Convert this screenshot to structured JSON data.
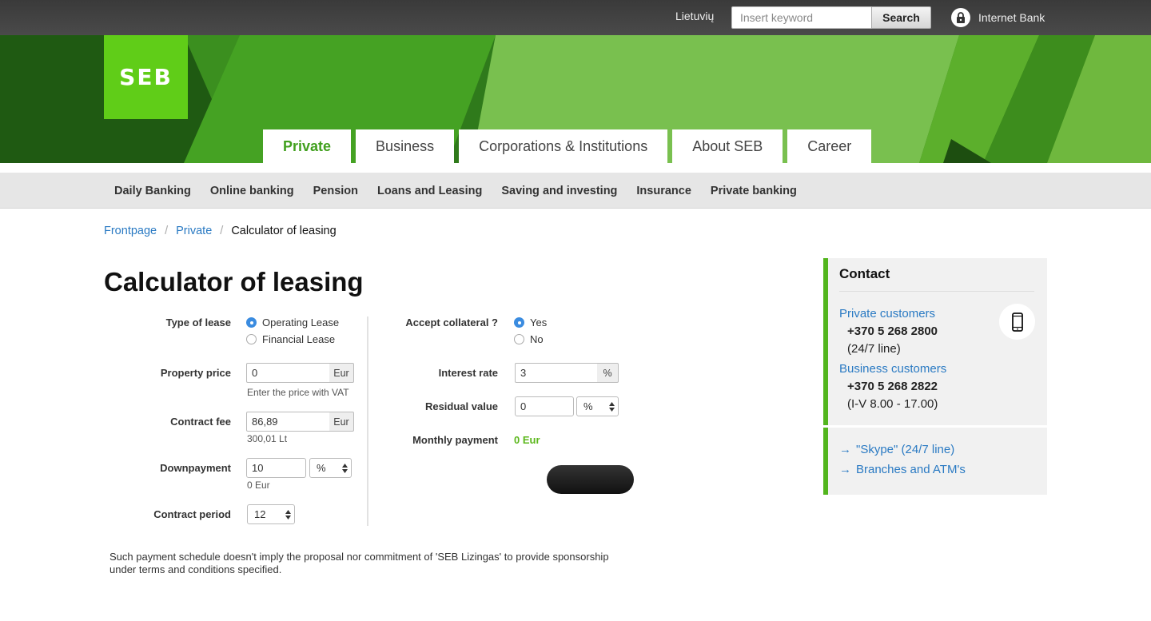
{
  "topbar": {
    "language": "Lietuvių",
    "search_placeholder": "Insert keyword",
    "search_button": "Search",
    "internet_bank": "Internet Bank"
  },
  "logo": {
    "text": "SEB"
  },
  "tabs": [
    {
      "label": "Private",
      "active": true
    },
    {
      "label": "Business"
    },
    {
      "label": "Corporations & Institutions"
    },
    {
      "label": "About SEB"
    },
    {
      "label": "Career"
    }
  ],
  "subnav": [
    "Daily Banking",
    "Online banking",
    "Pension",
    "Loans and Leasing",
    "Saving and investing",
    "Insurance",
    "Private banking"
  ],
  "breadcrumb": {
    "items": [
      "Frontpage",
      "Private"
    ],
    "separator": "/",
    "current": "Calculator of leasing"
  },
  "page_title": "Calculator of leasing",
  "form": {
    "type_of_lease": {
      "label": "Type of lease",
      "options": [
        "Operating Lease",
        "Financial Lease"
      ],
      "selected": "Operating Lease"
    },
    "property_price": {
      "label": "Property price",
      "value": "0",
      "unit": "Eur",
      "hint": "Enter the price with VAT"
    },
    "contract_fee": {
      "label": "Contract fee",
      "value": "86,89",
      "unit": "Eur",
      "hint": "300,01 Lt"
    },
    "downpayment": {
      "label": "Downpayment",
      "value": "10",
      "unit": "%",
      "hint": "0 Eur"
    },
    "contract_period": {
      "label": "Contract period",
      "value": "12"
    },
    "accept_collateral": {
      "label": "Accept collateral ?",
      "options": [
        "Yes",
        "No"
      ],
      "selected": "Yes"
    },
    "interest_rate": {
      "label": "Interest rate",
      "value": "3",
      "unit": "%"
    },
    "residual_value": {
      "label": "Residual value",
      "value": "0",
      "unit": "%"
    },
    "monthly_payment": {
      "label": "Monthly payment",
      "value": "0 Eur"
    }
  },
  "disclaimer": "Such payment schedule doesn't imply the proposal nor commitment of 'SEB Lizingas' to provide sponsorship under terms and conditions specified.",
  "contact": {
    "title": "Contact",
    "private_label": "Private customers",
    "private_phone": "+370 5 268 2800",
    "private_hours": "(24/7 line)",
    "business_label": "Business customers",
    "business_phone": "+370 5 268 2822",
    "business_hours": "(I-V 8.00 - 17.00)",
    "links": [
      "\"Skype\" (24/7 line)",
      "Branches and ATM's"
    ]
  },
  "colors": {
    "brand_green": "#60cd18",
    "link_blue": "#2a7ac3",
    "accent_green": "#52b51d"
  }
}
